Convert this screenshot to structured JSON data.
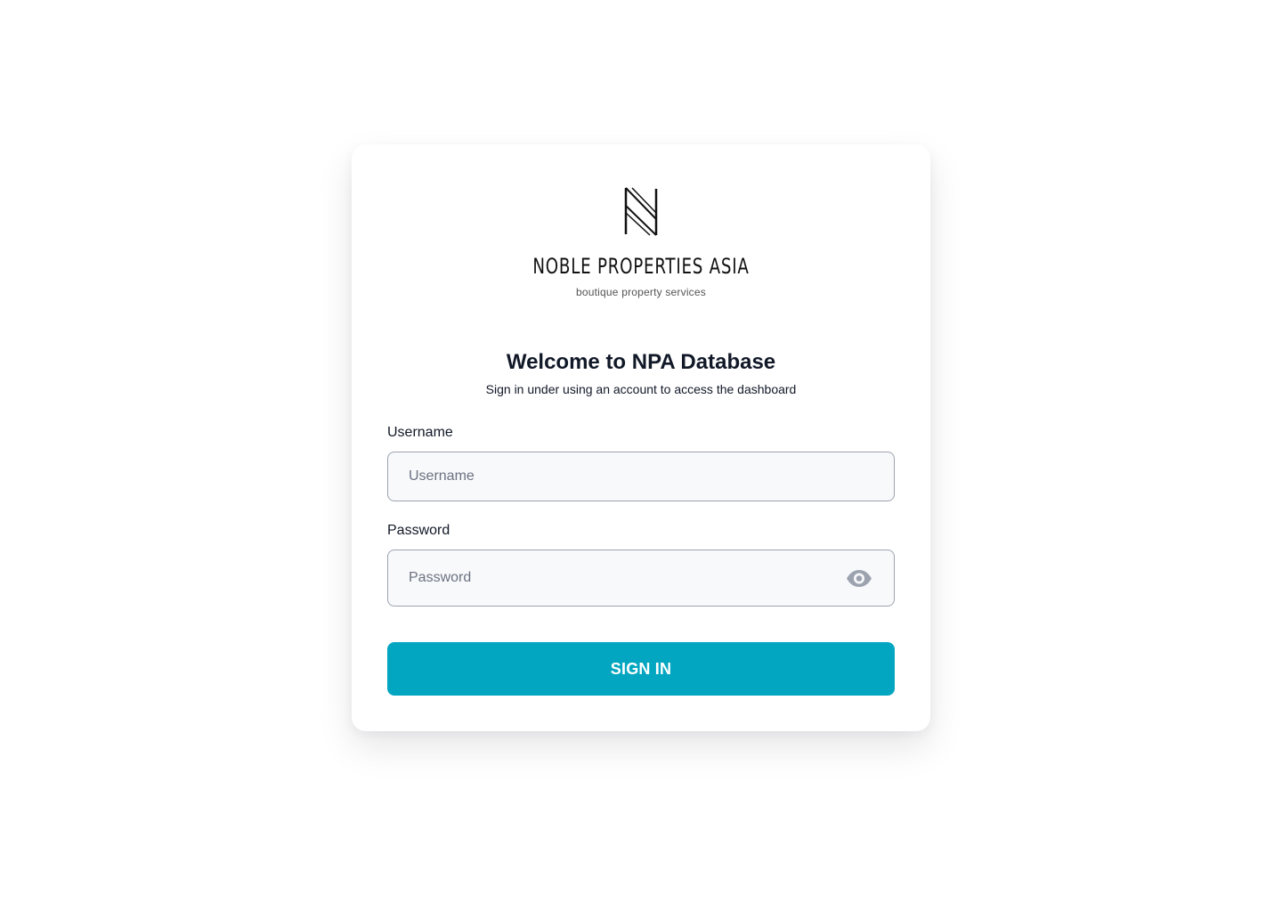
{
  "brand": {
    "name": "NOBLE PROPERTIES ASIA",
    "tagline": "boutique property services"
  },
  "login": {
    "heading": "Welcome to NPA Database",
    "subheading": "Sign in under using an account to access the dashboard",
    "username_label": "Username",
    "username_placeholder": "Username",
    "password_label": "Password",
    "password_placeholder": "Password",
    "sign_in_label": "SIGN IN"
  },
  "icons": {
    "show_password": "eye-icon"
  },
  "colors": {
    "accent": "#03a6c1",
    "field_background": "#f8f9fb",
    "field_border": "#9ca3af",
    "text_primary": "#111827",
    "text_placeholder": "#6b7280"
  }
}
